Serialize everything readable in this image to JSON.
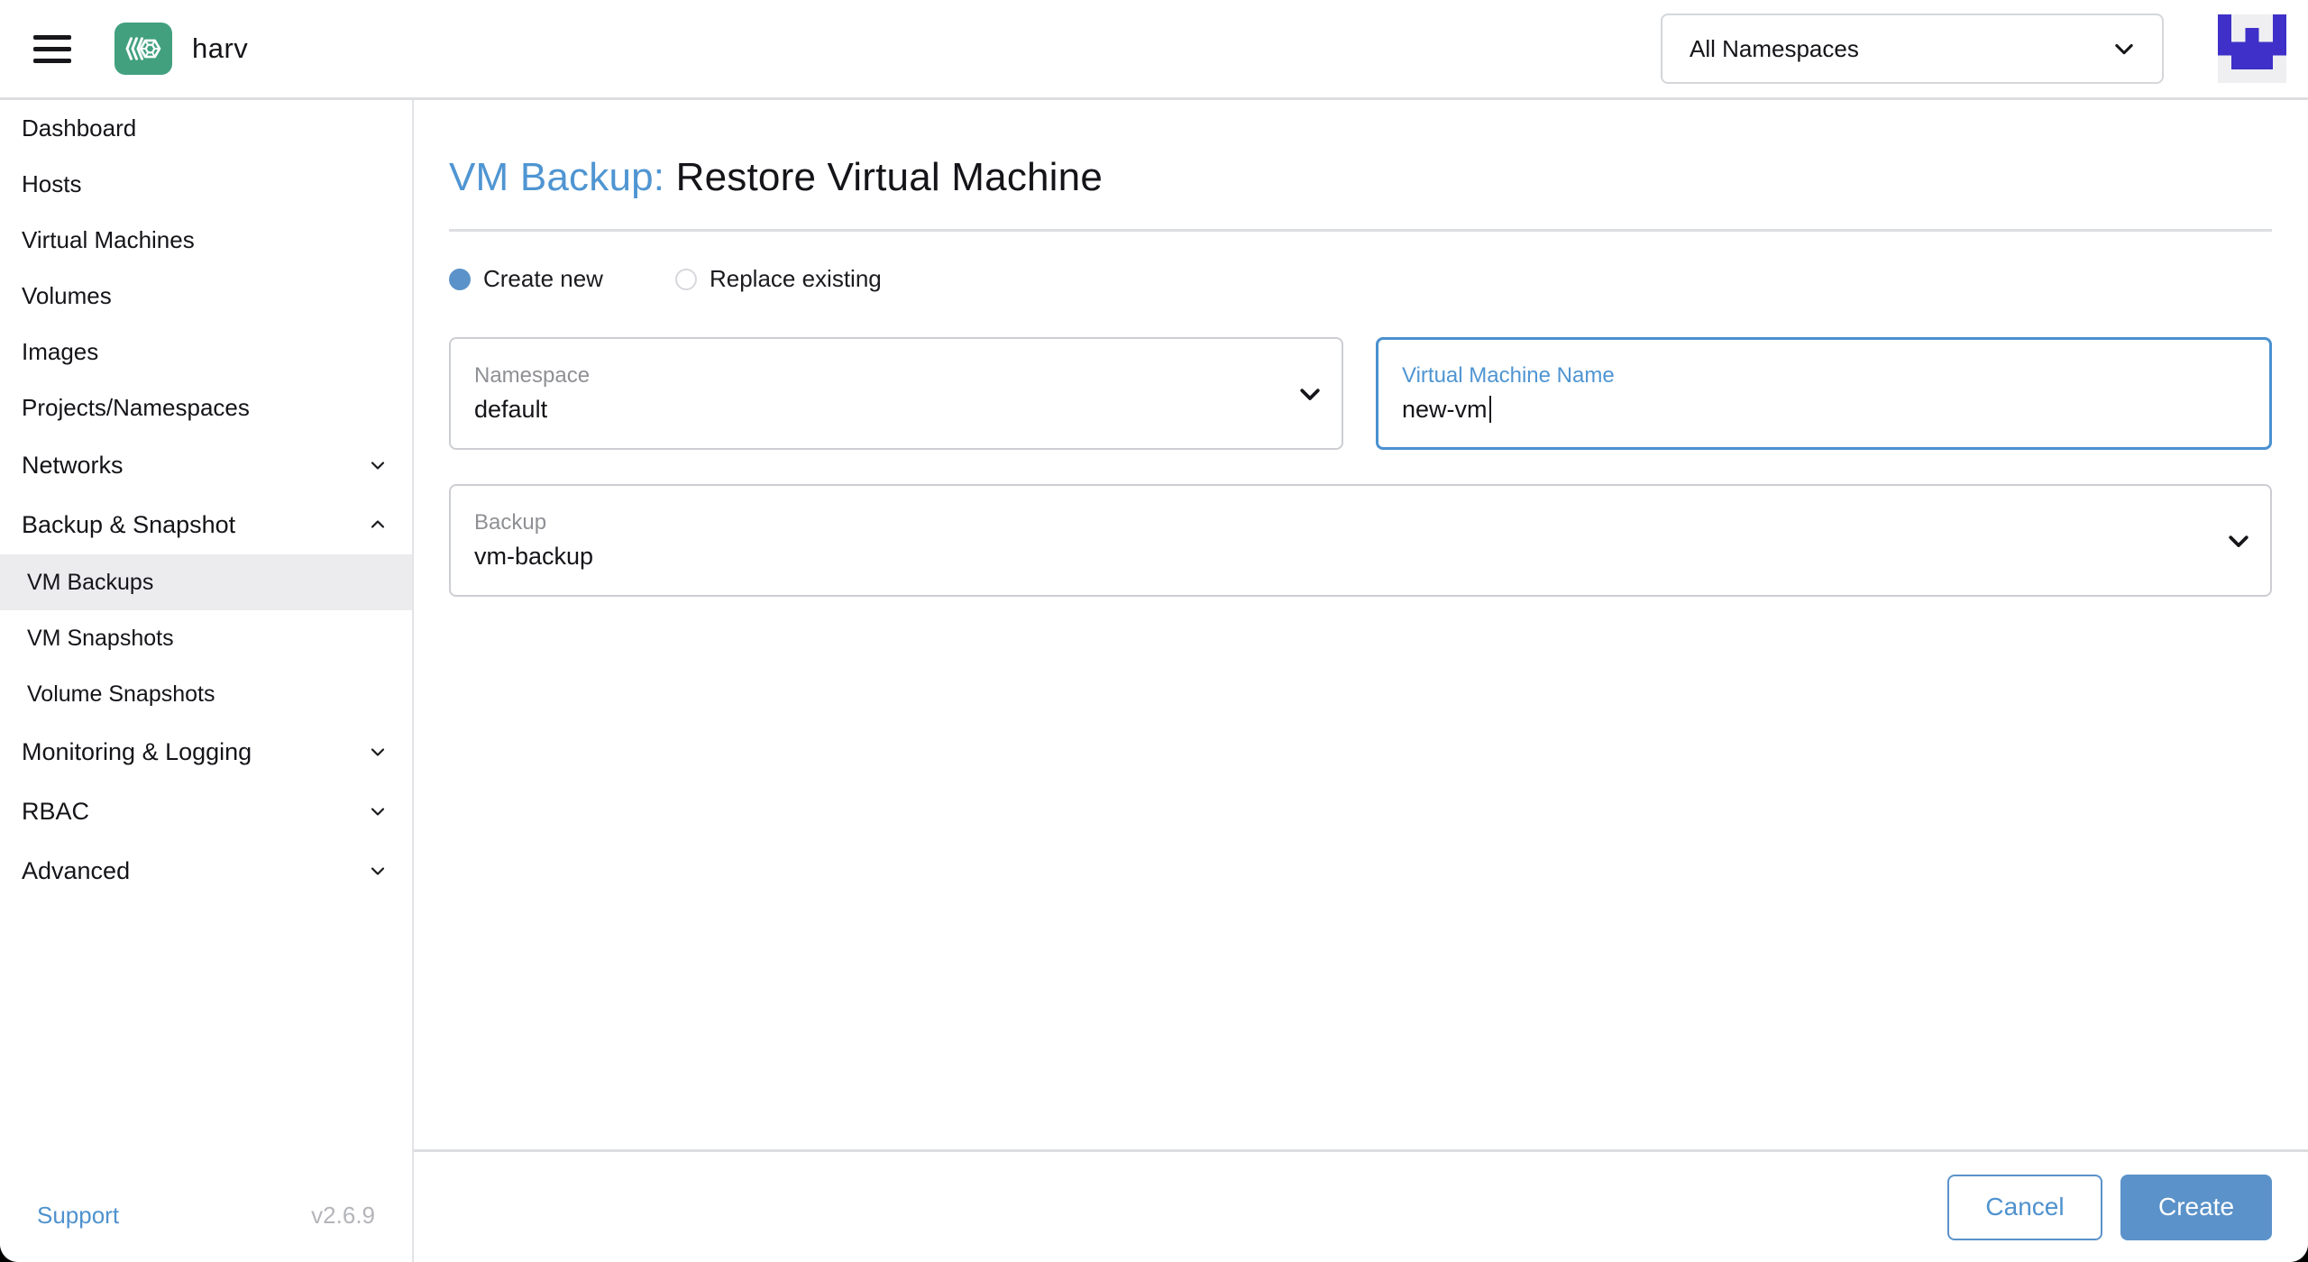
{
  "header": {
    "product_name": "harv",
    "namespace_filter": "All Namespaces"
  },
  "sidebar": {
    "items": [
      {
        "label": "Dashboard",
        "type": "link"
      },
      {
        "label": "Hosts",
        "type": "link"
      },
      {
        "label": "Virtual Machines",
        "type": "link"
      },
      {
        "label": "Volumes",
        "type": "link"
      },
      {
        "label": "Images",
        "type": "link"
      },
      {
        "label": "Projects/Namespaces",
        "type": "link"
      },
      {
        "label": "Networks",
        "type": "group",
        "state": "collapsed"
      },
      {
        "label": "Backup & Snapshot",
        "type": "group",
        "state": "expanded",
        "children": [
          "VM Backups",
          "VM Snapshots",
          "Volume Snapshots"
        ],
        "selected_child": "VM Backups"
      },
      {
        "label": "Monitoring & Logging",
        "type": "group",
        "state": "collapsed"
      },
      {
        "label": "RBAC",
        "type": "group",
        "state": "collapsed"
      },
      {
        "label": "Advanced",
        "type": "group",
        "state": "collapsed"
      }
    ],
    "footer": {
      "support_label": "Support",
      "version": "v2.6.9"
    }
  },
  "page": {
    "title_prefix": "VM Backup:",
    "title_main": "Restore Virtual Machine",
    "radios": {
      "create_new": "Create new",
      "replace_existing": "Replace existing",
      "selected": "Create new"
    },
    "fields": {
      "namespace": {
        "label": "Namespace",
        "value": "default"
      },
      "vm_name": {
        "label": "Virtual Machine Name",
        "value": "new-vm",
        "focused": true
      },
      "backup": {
        "label": "Backup",
        "value": "vm-backup"
      }
    },
    "actions": {
      "cancel_label": "Cancel",
      "create_label": "Create"
    }
  },
  "colors": {
    "primary_blue": "#5b92c9",
    "link_blue": "#4f95d2",
    "logo_green": "#42a07f",
    "avatar_indigo": "#3e30c8",
    "selected_item_bg": "#ececee",
    "divider_gray": "#dcdde0",
    "text_dark": "#141419",
    "label_gray": "#8f9094"
  }
}
